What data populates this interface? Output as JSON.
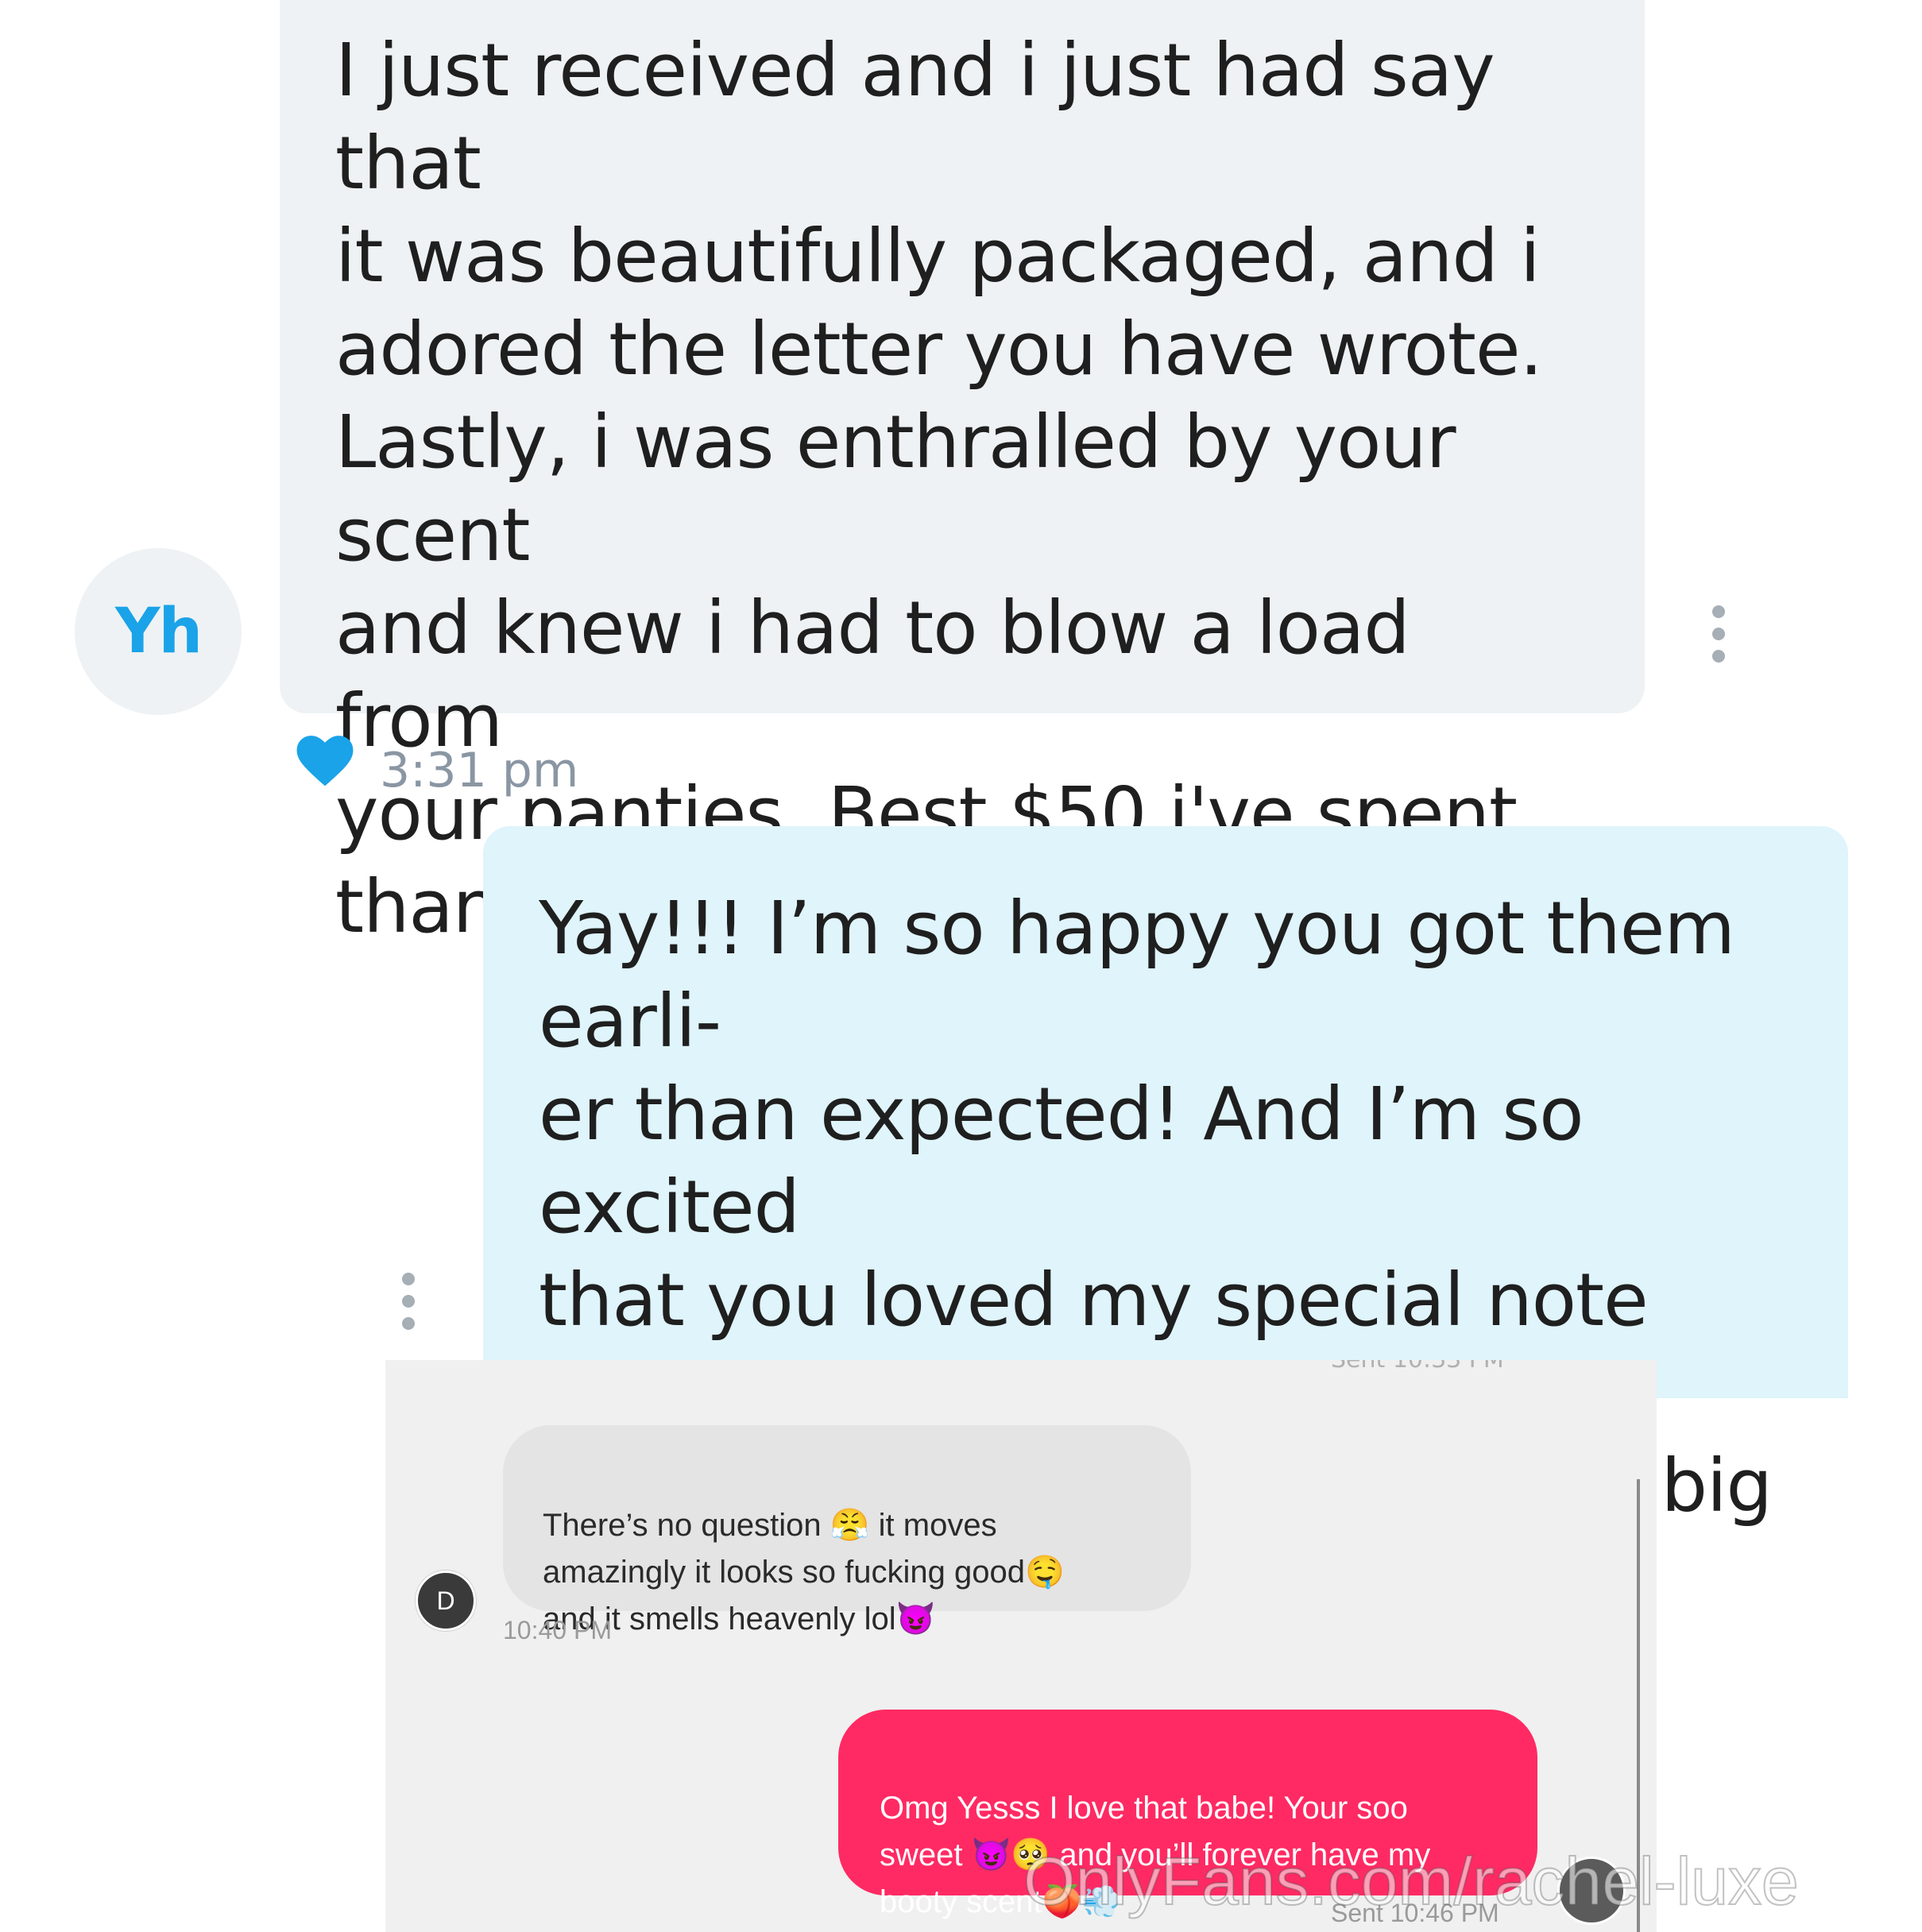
{
  "top_chat": {
    "sender_initials": "Yh",
    "incoming_message": "I just received and i just had say that\nit was beautifully packaged, and i\nadored the letter you have wrote.\nLastly, i was enthralled by your scent\nand knew i had to blow a load from\nyour panties. Best $50 i've spent,\nthank you",
    "incoming_time": "3:31 pm",
    "outgoing_message": "Yay!!! I’m so happy you got them earli-\ner than expected! And I’m so excited\nthat you loved my special note and\nmy scent 😈 I bet it was such a big\nload babe!💦",
    "like_color": "#1aa3e8"
  },
  "inset_chat": {
    "cutoff_label": "Sent 10:33 PM",
    "sender_initial": "D",
    "incoming_message": "There’s no question 😤 it moves\namazingly it looks so fucking good🤤\nand it smells heavenly lol😈",
    "incoming_time": "10:40 PM",
    "outgoing_message": "Omg Yesss I love that babe! Your soo\nsweet 😈🥺 and you’ll forever have my\nbooty scent🍑💨",
    "outgoing_status": "Sent 10:46 PM",
    "outgoing_color": "#ff2a63"
  },
  "watermark": "OnlyFans.com/rachel-luxe"
}
